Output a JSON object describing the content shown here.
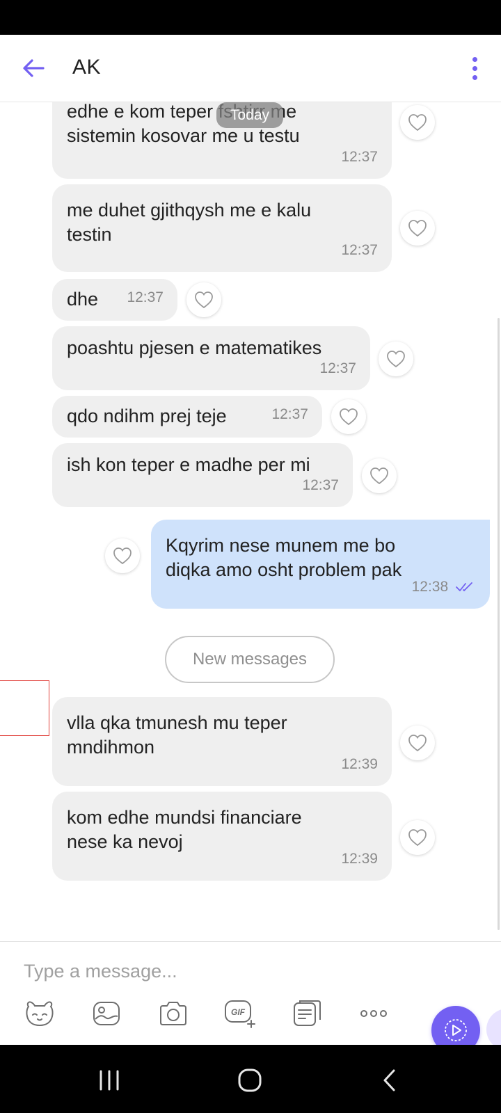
{
  "header": {
    "title": "AK"
  },
  "chat": {
    "today_label": "Today",
    "new_messages_label": "New messages",
    "messages": [
      {
        "lines": [
          "edhe e kom teper fshtirr me",
          "sistemin kosovar me u testu"
        ],
        "time": "12:37",
        "direction": "in"
      },
      {
        "lines": [
          "me duhet gjithqysh me e kalu",
          "testin"
        ],
        "time": "12:37",
        "direction": "in"
      },
      {
        "lines": [
          "dhe"
        ],
        "time": "12:37",
        "direction": "in"
      },
      {
        "lines": [
          "poashtu pjesen e matematikes"
        ],
        "time": "12:37",
        "direction": "in"
      },
      {
        "lines": [
          "qdo ndihm prej teje"
        ],
        "time": "12:37",
        "direction": "in"
      },
      {
        "lines": [
          "ish kon teper e madhe per mi"
        ],
        "time": "12:37",
        "direction": "in"
      },
      {
        "lines": [
          "Kqyrim nese munem me bo",
          "diqka amo osht problem pak"
        ],
        "time": "12:38",
        "direction": "out",
        "status": "seen"
      },
      {
        "lines": [
          "vlla qka tmunesh mu teper",
          "mndihmon"
        ],
        "time": "12:39",
        "direction": "in"
      },
      {
        "lines": [
          "kom edhe mundsi financiare",
          "nese ka nevoj"
        ],
        "time": "12:39",
        "direction": "in"
      }
    ]
  },
  "composer": {
    "placeholder": "Type a message...",
    "tools": [
      "sticker-icon",
      "gallery-icon",
      "camera-icon",
      "gif-icon",
      "notes-icon",
      "more-icon"
    ],
    "gif_label": "GIF"
  },
  "colors": {
    "accent": "#7360f2",
    "incoming_bubble": "#efefef",
    "outgoing_bubble": "#cfe2fb"
  }
}
